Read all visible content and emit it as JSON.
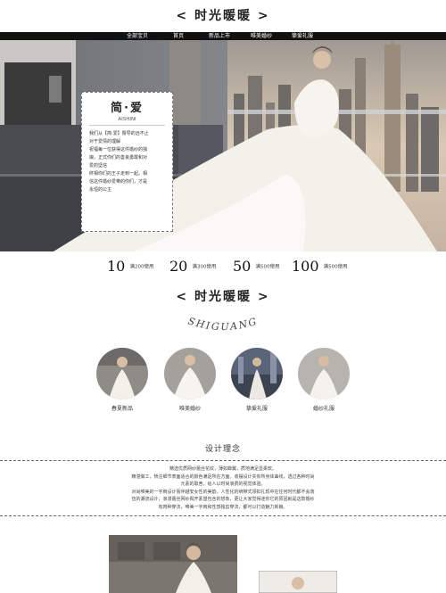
{
  "header": {
    "title": "< 时光暖暖 >"
  },
  "nav": {
    "items": [
      {
        "label": "全部宝贝"
      },
      {
        "label": "首页"
      },
      {
        "label": "新品上市"
      },
      {
        "label": "唯美婚纱"
      },
      {
        "label": "挚爱礼服"
      }
    ]
  },
  "hero": {
    "card": {
      "title": "简·爱",
      "subtitle": "AISHINI",
      "lines": [
        "我们从【简·爱】督导的远不止",
        "对于爱情的理解",
        "祝福每一位获得这件婚纱的独",
        "娘，正式你们的善良勇敢和对",
        "爱的坚信",
        "终相你们的王子走到一起。相",
        "信这件婚纱爱带的你们，才是",
        "永恒的公主"
      ]
    }
  },
  "coupons": [
    {
      "amount": "10",
      "condition": "满200使用"
    },
    {
      "amount": "20",
      "condition": "满300使用"
    },
    {
      "amount": "50",
      "condition": "满500使用"
    },
    {
      "amount": "100",
      "condition": "满500使用"
    }
  ],
  "section": {
    "title": "< 时光暖暖 >",
    "script_title": "SHIGUANG"
  },
  "categories": [
    {
      "label": "春夏新品"
    },
    {
      "label": "唯美婚纱"
    },
    {
      "label": "挚爱礼服"
    },
    {
      "label": "婚纱礼服"
    }
  ],
  "concept": {
    "title": "设计理念",
    "lines": [
      "精选优质网纱蕾丝花纹，薄如蝉翼，质地满足显柔软。",
      "精湛做工，矫注细节表面适合的颜色满足所在方面，收摆设计实你所身体曲线，透过各种时尚",
      "元素的取舍，给人以时尚浪费的视觉体验。",
      "对尚唯美的一字肩设计而伴越安女性的美韵，人性化的绑带式领扣扎现中在住何时代都不会落",
      "伍的潮流设计，浪漫蕾丝网纱揭开素盟包含的想象，更让大家觉得迷你它的原因就是这款婚纱",
      "有肉种穿法，唯美一字肩和性感独剪穿法，都可以打造魅力新娘。"
    ]
  },
  "colors": {
    "nav_bg": "#111111",
    "accent": "#222222"
  }
}
